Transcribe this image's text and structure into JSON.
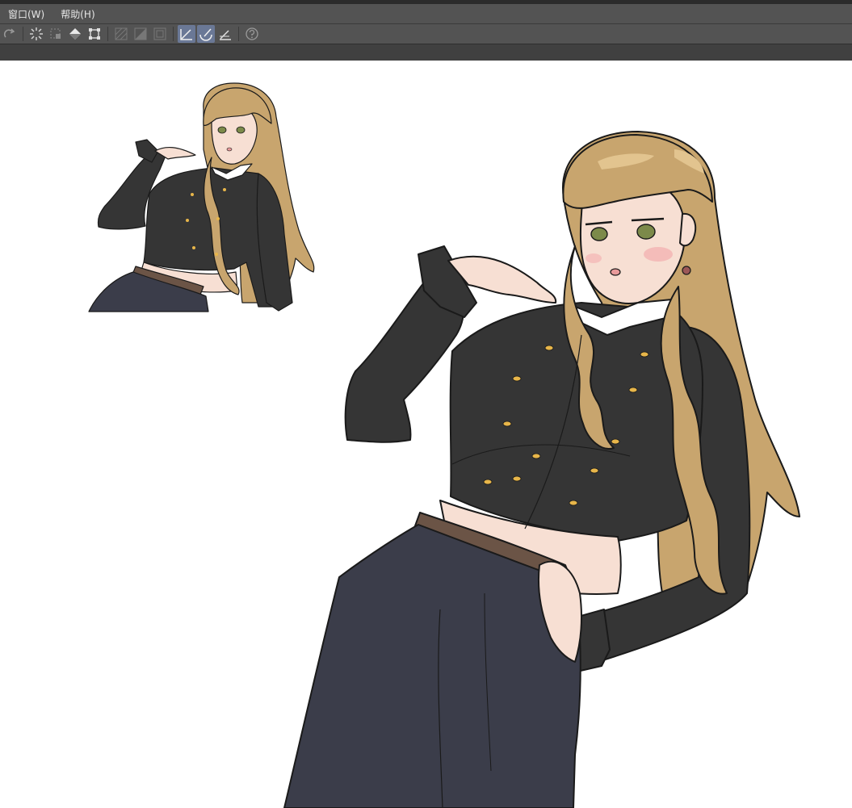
{
  "menubar": {
    "items": [
      {
        "label": "窗口(W)"
      },
      {
        "label": "帮助(H)"
      }
    ]
  },
  "toolbar": {
    "buttons": [
      {
        "icon": "redo-icon",
        "active": false
      },
      {
        "icon": "transform-spin-icon",
        "active": false
      },
      {
        "icon": "selection-icon",
        "active": false
      },
      {
        "icon": "fill-icon",
        "active": false
      },
      {
        "icon": "crop-icon",
        "active": false
      },
      {
        "icon": "ruler-hatch-icon",
        "active": false
      },
      {
        "icon": "ruler-half-icon",
        "active": false
      },
      {
        "icon": "ruler-frame-icon",
        "active": false
      },
      {
        "icon": "snap-ruler-icon",
        "active": true
      },
      {
        "icon": "snap-special-ruler-icon",
        "active": true
      },
      {
        "icon": "snap-grid-icon",
        "active": false
      },
      {
        "icon": "help-icon",
        "active": false
      }
    ]
  },
  "canvas": {
    "artwork": "illustration-character-two-views",
    "colors": {
      "hair": "#c8a56e",
      "hair_light": "#e2c48f",
      "jacket": "#353535",
      "pants": "#3b3d4a",
      "skin": "#f7dfd3",
      "belt": "#6b5446",
      "buttons": "#e8b64a",
      "collar": "#ffffff"
    }
  }
}
